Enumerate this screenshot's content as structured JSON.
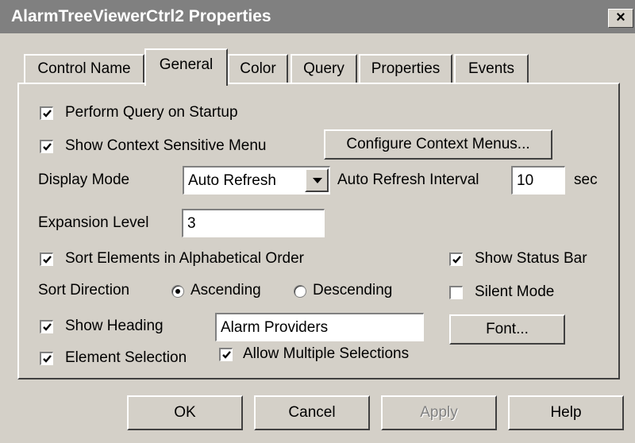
{
  "window": {
    "title": "AlarmTreeViewerCtrl2 Properties",
    "close_glyph": "×"
  },
  "tabs": [
    {
      "label": "Control Name"
    },
    {
      "label": "General",
      "active": true
    },
    {
      "label": "Color"
    },
    {
      "label": "Query"
    },
    {
      "label": "Properties"
    },
    {
      "label": "Events"
    }
  ],
  "general": {
    "perform_query": {
      "label": "Perform Query on Startup",
      "checked": true
    },
    "show_context_menu": {
      "label": "Show Context Sensitive Menu",
      "checked": true
    },
    "configure_context_menus_button": "Configure Context Menus...",
    "display_mode": {
      "label": "Display Mode",
      "value": "Auto Refresh"
    },
    "auto_refresh": {
      "label": "Auto Refresh Interval",
      "value": "10",
      "unit": "sec"
    },
    "expansion_level": {
      "label": "Expansion Level",
      "value": "3"
    },
    "sort_alphabetical": {
      "label": "Sort Elements in Alphabetical Order",
      "checked": true
    },
    "sort_direction": {
      "label": "Sort Direction",
      "ascending": "Ascending",
      "descending": "Descending",
      "selected": "Ascending"
    },
    "show_heading": {
      "label": "Show Heading",
      "checked": true,
      "value": "Alarm Providers"
    },
    "element_selection": {
      "label": "Element Selection",
      "checked": true
    },
    "allow_multiple": {
      "label": "Allow Multiple Selections",
      "checked": true
    },
    "show_status_bar": {
      "label": "Show Status Bar",
      "checked": true
    },
    "silent_mode": {
      "label": "Silent Mode",
      "checked": false
    },
    "font_button": "Font..."
  },
  "footer": {
    "ok": "OK",
    "cancel": "Cancel",
    "apply": "Apply",
    "help": "Help"
  }
}
